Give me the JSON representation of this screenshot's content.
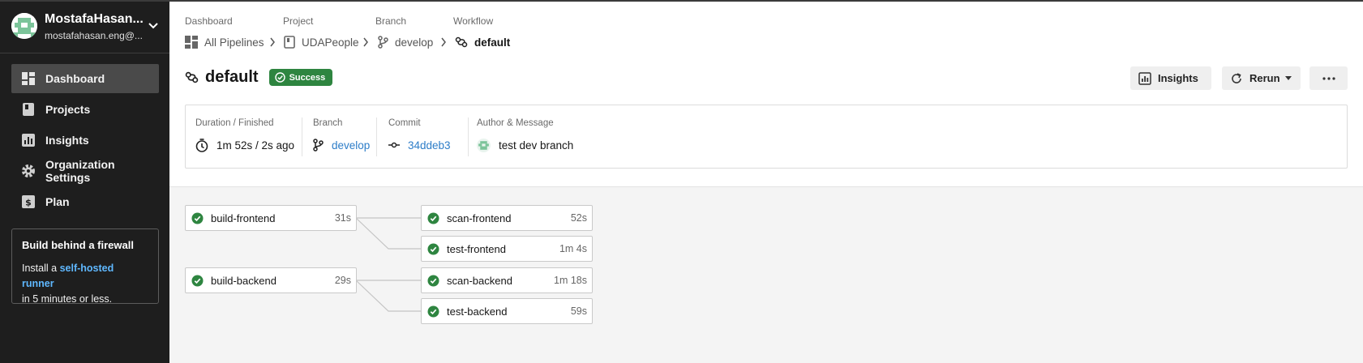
{
  "account": {
    "name": "MostafaHasan...",
    "email": "mostafahasan.eng@..."
  },
  "nav": {
    "items": [
      {
        "label": "Dashboard",
        "icon": "dashboard-icon",
        "active": true
      },
      {
        "label": "Projects",
        "icon": "projects-icon",
        "active": false
      },
      {
        "label": "Insights",
        "icon": "insights-icon",
        "active": false
      },
      {
        "label": "Organization Settings",
        "icon": "gear-icon",
        "active": false
      },
      {
        "label": "Plan",
        "icon": "plan-icon",
        "active": false
      }
    ]
  },
  "promo": {
    "title": "Build behind a firewall",
    "text_before": "Install a ",
    "link": "self-hosted runner",
    "text_after": "in 5 minutes or less."
  },
  "breadcrumb": [
    {
      "label": "Dashboard",
      "value": "All Pipelines",
      "icon": "pipelines-icon"
    },
    {
      "label": "Project",
      "value": "UDAPeople",
      "icon": "project-icon"
    },
    {
      "label": "Branch",
      "value": "develop",
      "icon": "branch-icon"
    },
    {
      "label": "Workflow",
      "value": "default",
      "icon": "workflow-icon"
    }
  ],
  "header": {
    "title": "default",
    "status": "Success"
  },
  "actions": {
    "insights": "Insights",
    "rerun": "Rerun"
  },
  "summary": {
    "duration_label": "Duration / Finished",
    "duration_value": "1m 52s / 2s ago",
    "branch_label": "Branch",
    "branch_value": "develop",
    "commit_label": "Commit",
    "commit_value": "34ddeb3",
    "author_label": "Author & Message",
    "author_message": "test dev branch"
  },
  "jobs": [
    {
      "name": "build-frontend",
      "duration": "31s",
      "status": "success"
    },
    {
      "name": "scan-frontend",
      "duration": "52s",
      "status": "success"
    },
    {
      "name": "test-frontend",
      "duration": "1m 4s",
      "status": "success"
    },
    {
      "name": "build-backend",
      "duration": "29s",
      "status": "success"
    },
    {
      "name": "scan-backend",
      "duration": "1m 18s",
      "status": "success"
    },
    {
      "name": "test-backend",
      "duration": "59s",
      "status": "success"
    }
  ],
  "colors": {
    "success": "#2e8540",
    "link": "#2d7dc8",
    "sidebar_bg": "#1e1e1e"
  }
}
